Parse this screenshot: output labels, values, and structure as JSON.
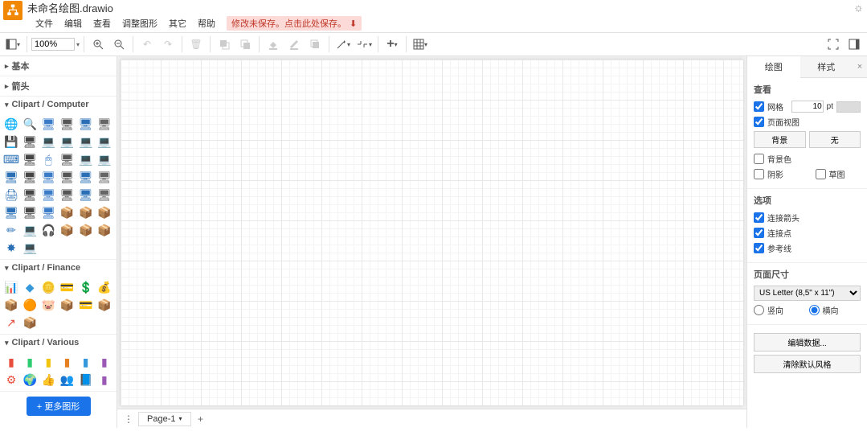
{
  "title": "未命名绘图.drawio",
  "menu": [
    "文件",
    "编辑",
    "查看",
    "调整图形",
    "其它",
    "帮助"
  ],
  "unsaved": "修改未保存。点击此处保存。",
  "zoom": "100%",
  "sidebar": {
    "collapsed": [
      "基本",
      "箭头"
    ],
    "sections": [
      {
        "title": "Clipart / Computer"
      },
      {
        "title": "Clipart / Finance"
      },
      {
        "title": "Clipart / Various"
      }
    ],
    "more": "+ 更多图形"
  },
  "page": {
    "name": "Page-1"
  },
  "right": {
    "tabs": [
      "绘图",
      "样式"
    ],
    "view": {
      "title": "查看",
      "grid": "网格",
      "gridSize": "10",
      "gridUnit": "pt",
      "pageView": "页面视图",
      "bg": "背景",
      "none": "无",
      "bgcolor": "背景色",
      "shadow": "阴影",
      "sketch": "草图"
    },
    "options": {
      "title": "选项",
      "arrows": "连接箭头",
      "points": "连接点",
      "guides": "参考线"
    },
    "pageSize": {
      "title": "页面尺寸",
      "value": "US Letter (8,5\" x 11\")",
      "portrait": "竖向",
      "landscape": "横向"
    },
    "editData": "编辑数据...",
    "resetStyle": "清除默认风格"
  }
}
